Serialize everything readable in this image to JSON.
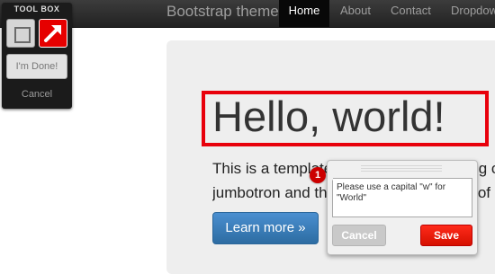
{
  "navbar": {
    "brand": "Bootstrap theme",
    "items": [
      {
        "label": "Home",
        "active": true
      },
      {
        "label": "About",
        "active": false
      },
      {
        "label": "Contact",
        "active": false
      },
      {
        "label": "Dropdown",
        "active": false
      }
    ]
  },
  "jumbotron": {
    "heading": "Hello, world!",
    "lead_line1": "This is a template for a simple marketing or",
    "lead_line2": "jumbotron and three supporting pieces of content.",
    "button_label": "Learn more »"
  },
  "toolbox": {
    "title": "TOOL BOX",
    "tools": [
      "rectangle-icon",
      "arrow-icon"
    ],
    "done_label": "I'm Done!",
    "cancel_label": "Cancel"
  },
  "comment": {
    "badge_number": "1",
    "text": "Please use a capital \"w\" for \"World\"",
    "cancel_label": "Cancel",
    "save_label": "Save"
  },
  "colors": {
    "highlight": "#e8000b",
    "save": "#e51400",
    "navbar": "#222222"
  }
}
